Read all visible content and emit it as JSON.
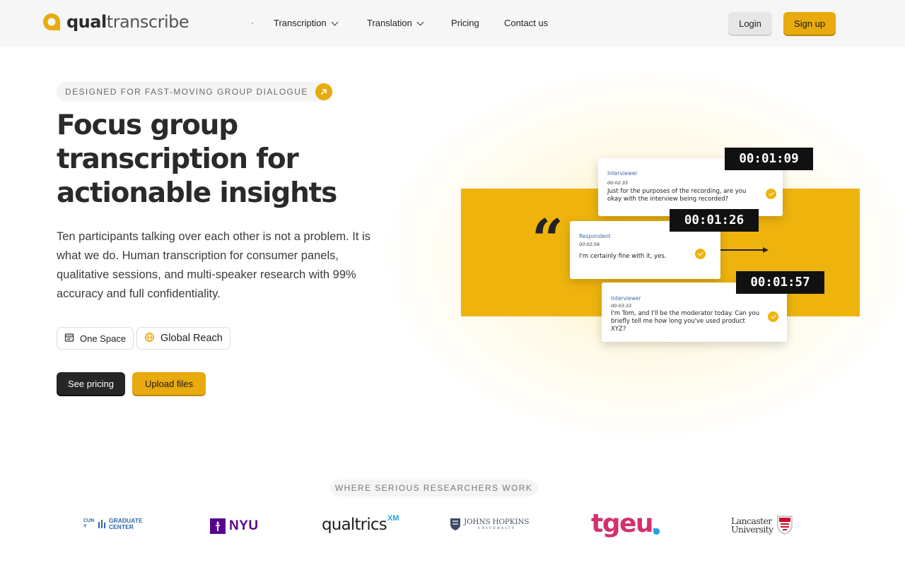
{
  "header": {
    "logo": {
      "bold": "qual",
      "light": "transcribe"
    },
    "nav": [
      {
        "label": "Transcription",
        "has_dropdown": true
      },
      {
        "label": "Translation",
        "has_dropdown": true
      },
      {
        "label": "Pricing",
        "has_dropdown": false
      },
      {
        "label": "Contact us",
        "has_dropdown": false
      }
    ],
    "login_label": "Login",
    "signup_label": "Sign up"
  },
  "hero": {
    "eyebrow": "DESIGNED FOR FAST-MOVING GROUP DIALOGUE",
    "headline": "Focus group transcription for actionable insights",
    "lede": "Ten participants talking over each other is not a problem. It is what we do. Human transcription for consumer panels, qualitative sessions, and multi-speaker research with 99% accuracy and full confidentiality.",
    "chips": [
      {
        "icon": "calendar-icon",
        "label": "One Space"
      },
      {
        "icon": "globe-icon",
        "label": "Global Reach"
      }
    ],
    "cta_primary": "See pricing",
    "cta_secondary": "Upload files"
  },
  "illustration": {
    "cards": [
      {
        "role": "Interviewer",
        "timestamp": "00:02:35",
        "text": "Just for the purposes of the recording, are you okay with the interview being recorded?",
        "timer": "00:01:09"
      },
      {
        "role": "Respondent",
        "timestamp": "00:02:56",
        "text": "I'm certainly fine with it, yes.",
        "timer": "00:01:26"
      },
      {
        "role": "Interviewer",
        "timestamp": "00:03:33",
        "text": "I'm Tom, and I'll be the moderator today. Can you briefly tell me how long you've used product XYZ?",
        "timer": "00:01:57"
      }
    ]
  },
  "researchers": {
    "label": "WHERE SERIOUS RESEARCHERS WORK",
    "logos": [
      {
        "name": "CUNY Graduate Center",
        "parts": [
          "CUNY",
          "GRADUATE",
          "CENTER"
        ]
      },
      {
        "name": "NYU",
        "parts": [
          "NYU"
        ]
      },
      {
        "name": "Qualtrics XM",
        "parts": [
          "qualtrics",
          "XM"
        ]
      },
      {
        "name": "Johns Hopkins University",
        "parts": [
          "JOHNS HOPKINS",
          "UNIVERSITY"
        ]
      },
      {
        "name": "tgeu",
        "parts": [
          "tgeu"
        ]
      },
      {
        "name": "Lancaster University",
        "parts": [
          "Lancaster",
          "University"
        ]
      }
    ]
  },
  "colors": {
    "accent": "#e8aa0d",
    "band": "#efb30d",
    "dark_button": "#262626",
    "nyu_purple": "#57068c",
    "tgeu_pink": "#d4306e",
    "tgeu_blue": "#2aa3de",
    "cuny_blue": "#2b66b0"
  }
}
